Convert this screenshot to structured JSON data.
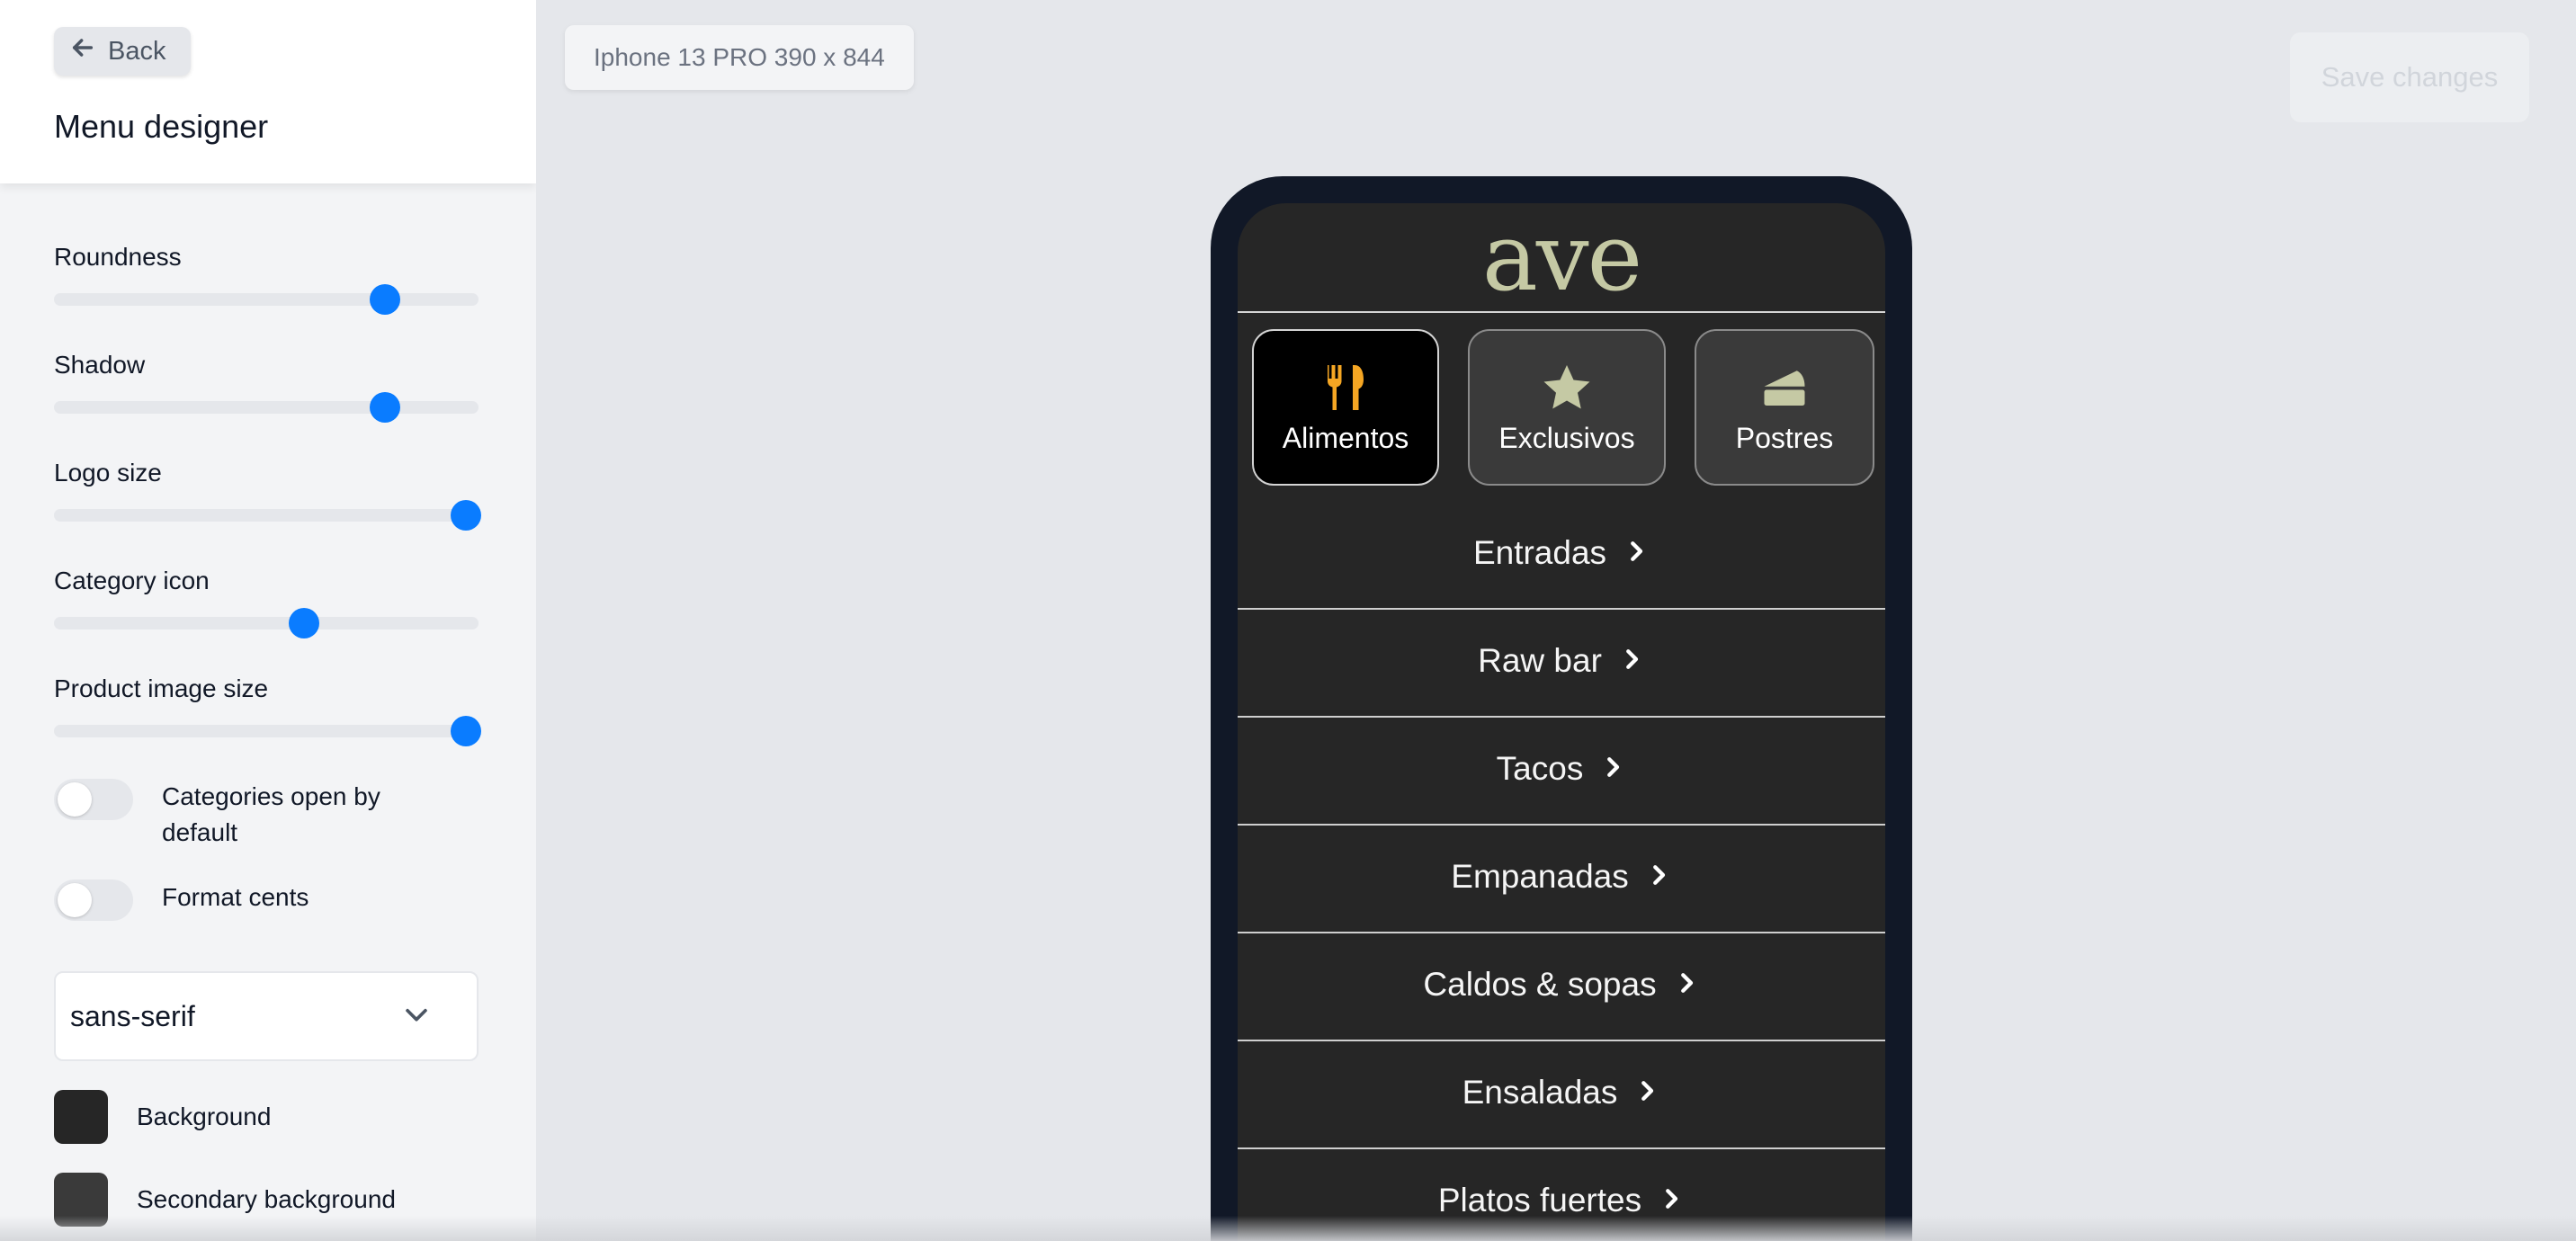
{
  "sidebar": {
    "back_label": "Back",
    "title": "Menu designer",
    "sliders": [
      {
        "label": "Roundness",
        "value": 0.78
      },
      {
        "label": "Shadow",
        "value": 0.78
      },
      {
        "label": "Logo size",
        "value": 0.97
      },
      {
        "label": "Category icon",
        "value": 0.59
      },
      {
        "label": "Product image size",
        "value": 0.97
      }
    ],
    "toggles": [
      {
        "label": "Categories open by default",
        "on": false
      },
      {
        "label": "Format cents",
        "on": false
      }
    ],
    "font_select": {
      "value": "sans-serif"
    },
    "colors": [
      {
        "label": "Background",
        "color": "#262626"
      },
      {
        "label": "Secondary background",
        "color": "#3a3a3a"
      }
    ]
  },
  "topbar": {
    "device_label": "Iphone 13 PRO 390 x 844",
    "save_label": "Save changes"
  },
  "preview": {
    "logo_text": "ave",
    "categories": [
      {
        "label": "Alimentos",
        "icon": "utensils-icon",
        "active": true,
        "icon_color": "#f5a623"
      },
      {
        "label": "Exclusivos",
        "icon": "star-icon",
        "active": false,
        "icon_color": "#c5c9a4"
      },
      {
        "label": "Postres",
        "icon": "cake-slice-icon",
        "active": false,
        "icon_color": "#c5c9a4"
      }
    ],
    "menu_items": [
      "Entradas",
      "Raw bar",
      "Tacos",
      "Empanadas",
      "Caldos & sopas",
      "Ensaladas",
      "Platos fuertes"
    ]
  },
  "colors": {
    "accent": "#0a7cff",
    "phone_frame": "#111827",
    "screen_bg": "#262626"
  }
}
